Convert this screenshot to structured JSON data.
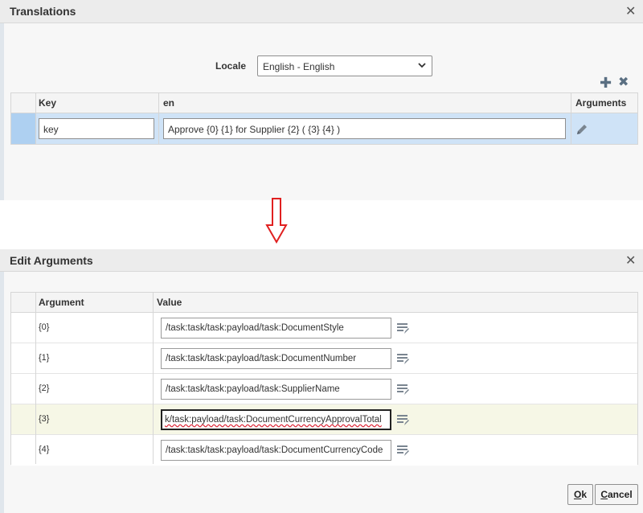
{
  "translations": {
    "title": "Translations",
    "locale_label": "Locale",
    "locale_value": "English - English",
    "columns": {
      "key": "Key",
      "en": "en",
      "arguments": "Arguments"
    },
    "row": {
      "key_value": "key",
      "en_value": "Approve  {0}  {1} for Supplier {2} ( {3} {4} )"
    }
  },
  "edit_arguments": {
    "title": "Edit Arguments",
    "columns": {
      "argument": "Argument",
      "value": "Value"
    },
    "rows": [
      {
        "argument": "{0}",
        "value": "/task:task/task:payload/task:DocumentStyle"
      },
      {
        "argument": "{1}",
        "value": "/task:task/task:payload/task:DocumentNumber"
      },
      {
        "argument": "{2}",
        "value": "/task:task/task:payload/task:SupplierName"
      },
      {
        "argument": "{3}",
        "value": "k/task:payload/task:DocumentCurrencyApprovalTotal"
      },
      {
        "argument": "{4}",
        "value": "/task:task/task:payload/task:DocumentCurrencyCode"
      }
    ],
    "ok_mnemonic": "O",
    "ok_rest": "k",
    "cancel_mnemonic": "C",
    "cancel_rest": "ancel"
  },
  "colors": {
    "selected_row": "#cfe3f7",
    "highlight_row": "#f6f7e6",
    "arrow": "#e02020"
  }
}
